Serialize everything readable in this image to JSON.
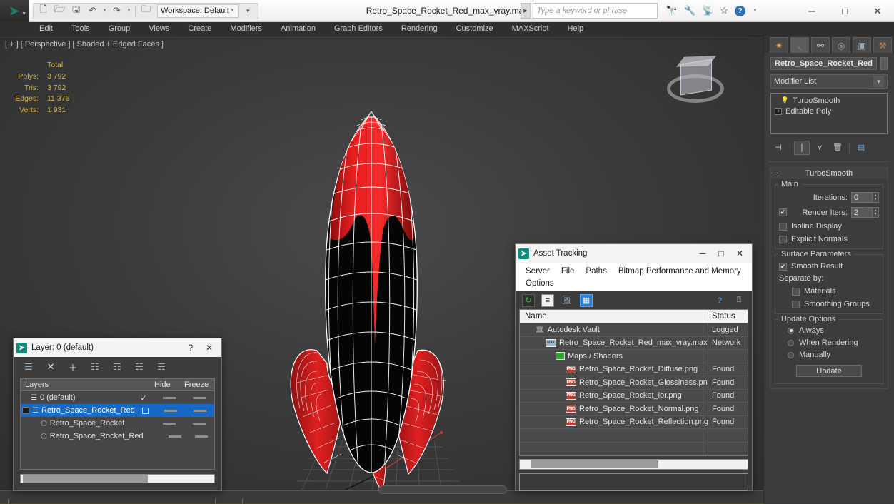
{
  "app": {
    "title": "Retro_Space_Rocket_Red_max_vray.max",
    "logo_glyph": "➤",
    "workspace_label": "Workspace: Default",
    "search_placeholder": "Type a keyword or phrase",
    "quick_access": [
      {
        "name": "new-file-icon",
        "glyph": "὜B"
      },
      {
        "name": "open-file-icon",
        "glyph": "὜1"
      },
      {
        "name": "save-file-icon",
        "glyph": "὚B"
      },
      {
        "name": "undo-icon",
        "glyph": "↶"
      },
      {
        "name": "redo-icon",
        "glyph": "↷"
      },
      {
        "name": "project-folder-icon",
        "glyph": "ὛF"
      }
    ],
    "title_icons": [
      {
        "name": "search-binoculars-icon",
        "glyph": "ὓE"
      },
      {
        "name": "wrench-icon",
        "glyph": "ὒ7"
      },
      {
        "name": "satellite-icon",
        "glyph": "὎1"
      },
      {
        "name": "star-favorite-icon",
        "glyph": "☆"
      }
    ],
    "help_label": "?",
    "window_buttons": {
      "minimize": "─",
      "maximize": "□",
      "close": "✕"
    }
  },
  "menubar": {
    "items": [
      "Edit",
      "Tools",
      "Group",
      "Views",
      "Create",
      "Modifiers",
      "Animation",
      "Graph Editors",
      "Rendering",
      "Customize",
      "MAXScript",
      "Help"
    ]
  },
  "viewport": {
    "label": "[ + ] [ Perspective ] [ Shaded + Edged Faces ]",
    "stats": {
      "header": "Total",
      "rows": [
        {
          "label": "Polys:",
          "value": "3 792"
        },
        {
          "label": "Tris:",
          "value": "3 792"
        },
        {
          "label": "Edges:",
          "value": "11 376"
        },
        {
          "label": "Verts:",
          "value": "1 931"
        }
      ]
    },
    "colors": {
      "body_black": "#050505",
      "accent_red": "#e01b1b",
      "wireframe": "#ffffff",
      "grid": "#6e6e6e",
      "axis_red": "#d04040"
    }
  },
  "command_panel": {
    "tabs": [
      {
        "name": "create-tab",
        "glyph": "✹"
      },
      {
        "name": "modify-tab",
        "glyph": "◜"
      },
      {
        "name": "hierarchy-tab",
        "glyph": "⚬"
      },
      {
        "name": "motion-tab",
        "glyph": "◎"
      },
      {
        "name": "display-tab",
        "glyph": "▣"
      },
      {
        "name": "utilities-tab",
        "glyph": "⚒"
      }
    ],
    "object_name": "Retro_Space_Rocket_Red",
    "modifier_list_label": "Modifier List",
    "stack": [
      {
        "label": "TurboSmooth",
        "icon": "lightbulb-icon"
      },
      {
        "label": "Editable Poly",
        "icon": "plus-expand-icon"
      }
    ],
    "stack_tools": [
      {
        "name": "pin-stack-icon",
        "glyph": "⊣"
      },
      {
        "name": "show-end-result-icon",
        "glyph": "⌶"
      },
      {
        "name": "make-unique-icon",
        "glyph": "ⅴ"
      },
      {
        "name": "remove-modifier-icon",
        "glyph": "Ὕ1"
      },
      {
        "name": "configure-sets-icon",
        "glyph": "▦"
      }
    ],
    "rollout": {
      "title": "TurboSmooth",
      "main_group": "Main",
      "iterations_label": "Iterations:",
      "iterations_value": "0",
      "render_iters_label": "Render Iters:",
      "render_iters_value": "2",
      "render_iters_checked": true,
      "isoline_display": {
        "label": "Isoline Display",
        "checked": false
      },
      "explicit_normals": {
        "label": "Explicit Normals",
        "checked": false
      },
      "surface_group": "Surface Parameters",
      "smooth_result": {
        "label": "Smooth Result",
        "checked": true
      },
      "separate_by_label": "Separate by:",
      "materials": {
        "label": "Materials",
        "checked": false
      },
      "smoothing_groups": {
        "label": "Smoothing Groups",
        "checked": false
      },
      "update_group": "Update Options",
      "update_modes": [
        {
          "label": "Always",
          "selected": true
        },
        {
          "label": "When Rendering",
          "selected": false
        },
        {
          "label": "Manually",
          "selected": false
        }
      ],
      "update_button": "Update"
    }
  },
  "layer_dialog": {
    "title": "Layer: 0 (default)",
    "help_btn": "?",
    "close_btn": "✕",
    "toolbar": [
      {
        "name": "new-layer-icon",
        "glyph": "☰"
      },
      {
        "name": "delete-layer-icon",
        "glyph": "✕"
      },
      {
        "name": "add-layer-icon",
        "glyph": "＋"
      },
      {
        "name": "select-objects-in-layer-icon",
        "glyph": "☷"
      },
      {
        "name": "highlight-selected-objects-icon",
        "glyph": "☶"
      },
      {
        "name": "add-selection-to-layer-icon",
        "glyph": "☵"
      },
      {
        "name": "set-current-layer-icon",
        "glyph": "☴"
      }
    ],
    "columns": [
      "Layers",
      "",
      "Hide",
      "Freeze"
    ],
    "rows": [
      {
        "label": "0 (default)",
        "indent": 0,
        "type": "layer",
        "current": true,
        "selected": false,
        "expander": false
      },
      {
        "label": "Retro_Space_Rocket_Red",
        "indent": 0,
        "type": "layer",
        "current": false,
        "selected": true,
        "expander": true
      },
      {
        "label": "Retro_Space_Rocket",
        "indent": 1,
        "type": "object",
        "current": false,
        "selected": false,
        "expander": false
      },
      {
        "label": "Retro_Space_Rocket_Red",
        "indent": 1,
        "type": "object",
        "current": false,
        "selected": false,
        "expander": false
      }
    ]
  },
  "asset_dialog": {
    "title": "Asset Tracking",
    "window_buttons": {
      "minimize": "─",
      "maximize": "□",
      "close": "✕"
    },
    "menus_row1": [
      "Server",
      "File",
      "Paths",
      "Bitmap Performance and Memory"
    ],
    "menus_row2": [
      "Options"
    ],
    "toolbar": [
      {
        "name": "refresh-icon",
        "glyph": "↻",
        "selected": false
      },
      {
        "name": "list-view-icon",
        "glyph": "≡",
        "selected": false
      },
      {
        "name": "thumbnail-view-icon",
        "glyph": "ὛC",
        "selected": false
      },
      {
        "name": "grid-view-icon",
        "glyph": "▦",
        "selected": true
      }
    ],
    "help_icons": [
      {
        "name": "help-icon",
        "glyph": "?"
      },
      {
        "name": "context-help-icon",
        "glyph": "⍰"
      }
    ],
    "columns": [
      "Name",
      "Status"
    ],
    "rows": [
      {
        "name": "Autodesk Vault",
        "status": "Logged",
        "indent": 1,
        "icon": "vault-icon"
      },
      {
        "name": "Retro_Space_Rocket_Red_max_vray.max",
        "status": "Network",
        "indent": 2,
        "icon": "max-file-icon"
      },
      {
        "name": "Maps / Shaders",
        "status": "",
        "indent": 3,
        "icon": "maps-folder-icon"
      },
      {
        "name": "Retro_Space_Rocket_Diffuse.png",
        "status": "Found",
        "indent": 4,
        "icon": "png-file-icon"
      },
      {
        "name": "Retro_Space_Rocket_Glossiness.png",
        "status": "Found",
        "indent": 4,
        "icon": "png-file-icon"
      },
      {
        "name": "Retro_Space_Rocket_ior.png",
        "status": "Found",
        "indent": 4,
        "icon": "png-file-icon"
      },
      {
        "name": "Retro_Space_Rocket_Normal.png",
        "status": "Found",
        "indent": 4,
        "icon": "png-file-icon"
      },
      {
        "name": "Retro_Space_Rocket_Reflection.png",
        "status": "Found",
        "indent": 4,
        "icon": "png-file-icon"
      },
      {
        "name": "",
        "status": "",
        "indent": 0,
        "icon": ""
      },
      {
        "name": "",
        "status": "",
        "indent": 0,
        "icon": ""
      }
    ]
  }
}
